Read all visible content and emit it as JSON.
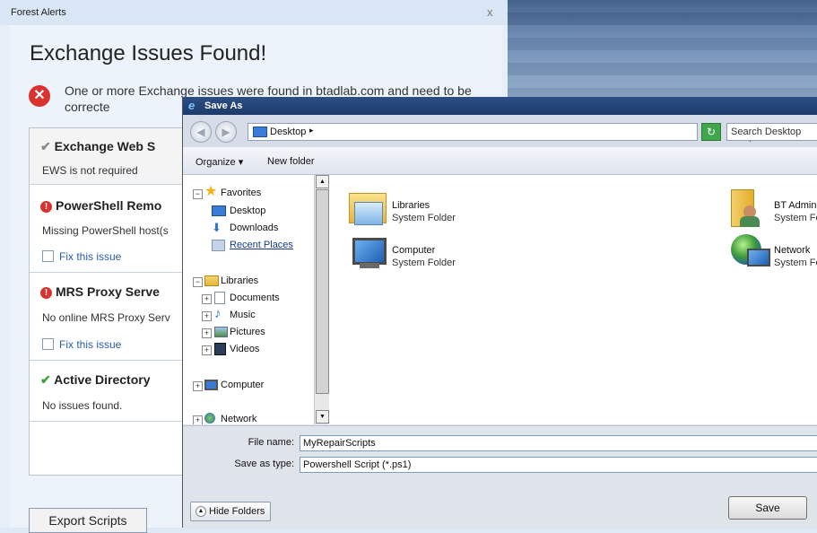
{
  "background_window": {
    "title": "Forest Alerts",
    "close_glyph": "x",
    "heading": "Exchange Issues Found!",
    "error_glyph": "✕",
    "intro": "One or more Exchange issues were found in btadlab.com and need to be correcte",
    "issues": [
      {
        "status": "ok",
        "title": "Exchange Web S",
        "description": "EWS is not required"
      },
      {
        "status": "error",
        "title": "PowerShell Remo",
        "description": "Missing PowerShell host(s",
        "fix_label": "Fix this issue"
      },
      {
        "status": "error",
        "title": "MRS Proxy Serve",
        "description": "No online MRS Proxy Serv",
        "fix_label": "Fix this issue"
      },
      {
        "status": "ok_green",
        "title": "Active Directory",
        "description": "No issues found."
      }
    ],
    "export_button": "Export Scripts"
  },
  "dialog": {
    "title": "Save As",
    "address": {
      "location": "Desktop",
      "chevron": "▸",
      "dropdown": "▼"
    },
    "search_placeholder": "Search Desktop",
    "nav": {
      "back": "◀",
      "forward": "▶",
      "refresh": "↻"
    },
    "toolbar": {
      "organize": "Organize ▾",
      "new_folder": "New folder"
    },
    "tree": {
      "favorites": "Favorites",
      "desktop": "Desktop",
      "downloads": "Downloads",
      "recent_places": "Recent Places",
      "libraries": "Libraries",
      "documents": "Documents",
      "music": "Music",
      "pictures": "Pictures",
      "videos": "Videos",
      "computer": "Computer",
      "network": "Network",
      "collapse_glyph": "−",
      "expand_glyph": "+"
    },
    "items": [
      {
        "name": "Libraries",
        "type": "System Folder",
        "icon": "libraries-icon"
      },
      {
        "name": "BT Admin",
        "type": "System Folder",
        "icon": "user-folder-icon"
      },
      {
        "name": "Computer",
        "type": "System Folder",
        "icon": "computer-icon"
      },
      {
        "name": "Network",
        "type": "System Folder",
        "icon": "network-icon"
      }
    ],
    "file_name_label": "File name:",
    "file_name_value": "MyRepairScripts",
    "save_type_label": "Save as type:",
    "save_type_value": "Powershell Script (*.ps1)",
    "hide_folders": "Hide Folders",
    "hide_folders_glyph": "▲",
    "save_button": "Save"
  }
}
